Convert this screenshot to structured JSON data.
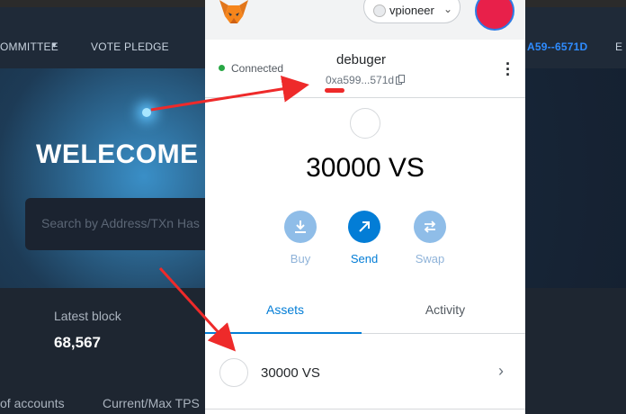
{
  "background": {
    "nav": {
      "committee": "OMMITTEE",
      "vote_pledge": "VOTE PLEDGE",
      "address": "A59--6571D",
      "extra": "E"
    },
    "hero": {
      "title": "WELECOME T",
      "search_placeholder": "Search by Address/TXn Has"
    },
    "stats": {
      "latest_block_label": "Latest block",
      "latest_block_value": "68,567",
      "accounts_label": "of accounts",
      "tps_label": "Current/Max TPS"
    }
  },
  "wallet": {
    "network_label": "vpioneer",
    "connected_text": "Connected",
    "account_name": "debuger",
    "account_address": "0xa599...571d",
    "balance": "30000 VS",
    "actions": [
      {
        "label": "Buy",
        "icon": "download-icon"
      },
      {
        "label": "Send",
        "icon": "arrow-up-right-icon"
      },
      {
        "label": "Swap",
        "icon": "swap-icon"
      }
    ],
    "tabs": {
      "assets": "Assets",
      "activity": "Activity"
    },
    "asset": {
      "name": "30000 VS"
    }
  },
  "colors": {
    "accent": "#037dd6",
    "annotation": "#ee2a2a",
    "connected": "#28a745"
  }
}
